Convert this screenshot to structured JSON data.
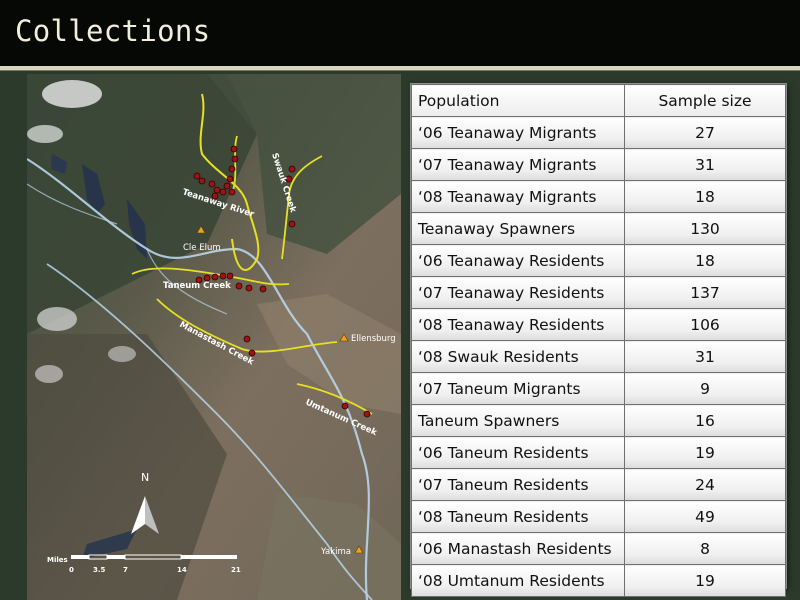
{
  "slide": {
    "title": "Collections"
  },
  "map": {
    "stream_labels": {
      "teanaway": "Teanaway River",
      "swauk": "Swauk Creek",
      "taneum": "Taneum Creek",
      "manastash": "Manastash Creek",
      "umtanum": "Umtanum Creek"
    },
    "towns": {
      "cle_elum": "Cle Elum",
      "ellensburg": "Ellensburg",
      "yakima": "Yakima"
    },
    "north_label": "N",
    "scale": {
      "unit": "Miles",
      "ticks": [
        "0",
        "3.5",
        "7",
        "14",
        "21"
      ]
    }
  },
  "table": {
    "headers": [
      "Population",
      "Sample size"
    ],
    "rows": [
      {
        "population": "‘06 Teanaway Migrants",
        "size": "27"
      },
      {
        "population": "‘07 Teanaway Migrants",
        "size": "31"
      },
      {
        "population": "‘08 Teanaway Migrants",
        "size": "18"
      },
      {
        "population": "Teanaway Spawners",
        "size": "130"
      },
      {
        "population": "‘06 Teanaway Residents",
        "size": "18"
      },
      {
        "population": "‘07 Teanaway Residents",
        "size": "137"
      },
      {
        "population": "‘08 Teanaway Residents",
        "size": "106"
      },
      {
        "population": "‘08 Swauk Residents",
        "size": "31"
      },
      {
        "population": "‘07 Taneum Migrants",
        "size": "9"
      },
      {
        "population": "Taneum Spawners",
        "size": "16"
      },
      {
        "population": "‘06 Taneum Residents",
        "size": "19"
      },
      {
        "population": "‘07 Taneum Residents",
        "size": "24"
      },
      {
        "population": "‘08 Taneum Residents",
        "size": "49"
      },
      {
        "population": "‘06 Manastash Residents",
        "size": "8"
      },
      {
        "population": "‘08 Umtanum Residents",
        "size": "19"
      }
    ]
  },
  "colors": {
    "stream": "#e6e023",
    "site": "#9e1414",
    "river": "#b9d5ea",
    "town": "#f0a020"
  }
}
